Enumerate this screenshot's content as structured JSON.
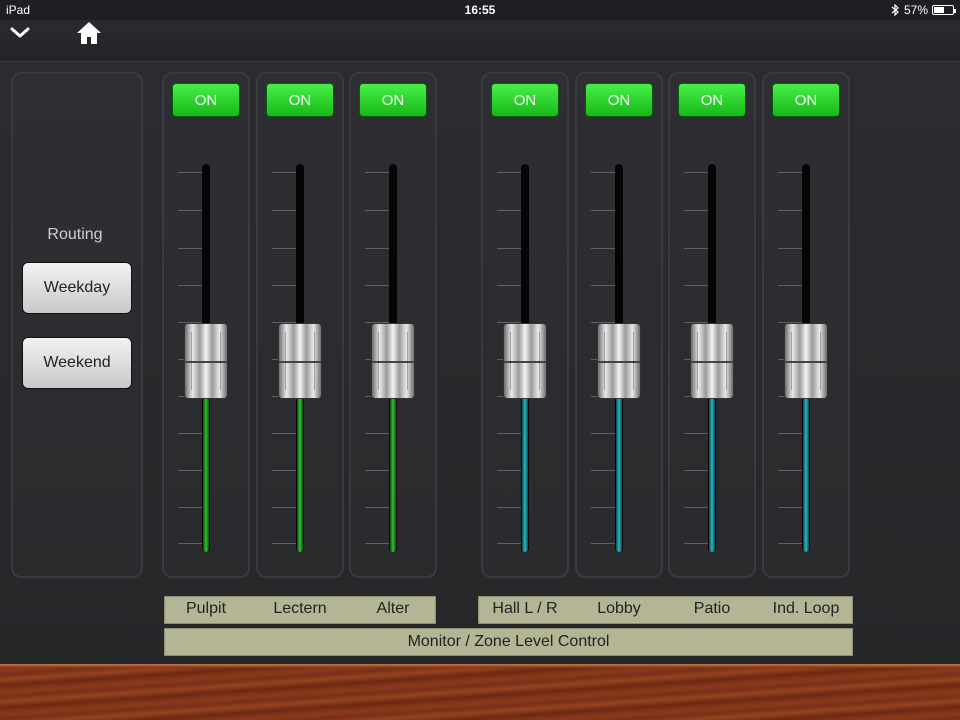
{
  "status_bar": {
    "device": "iPad",
    "time": "16:55",
    "battery": "57%",
    "battery_level": 0.57
  },
  "toolbar": {
    "left_icon": "chevron-down-icon",
    "home_icon": "home-icon"
  },
  "routing": {
    "label": "Routing",
    "buttons": [
      "Weekday",
      "Weekend"
    ]
  },
  "channels": [
    {
      "name": "Pulpit",
      "on_label": "ON",
      "level": 0.5,
      "color": "#2ec12e"
    },
    {
      "name": "Lectern",
      "on_label": "ON",
      "level": 0.5,
      "color": "#2ec12e"
    },
    {
      "name": "Alter",
      "on_label": "ON",
      "level": 0.5,
      "color": "#2ec12e"
    },
    {
      "name": "Hall L / R",
      "on_label": "ON",
      "level": 0.5,
      "color": "#27b6c1"
    },
    {
      "name": "Lobby",
      "on_label": "ON",
      "level": 0.5,
      "color": "#27b6c1"
    },
    {
      "name": "Patio",
      "on_label": "ON",
      "level": 0.5,
      "color": "#27b6c1"
    },
    {
      "name": "Ind. Loop",
      "on_label": "ON",
      "level": 0.5,
      "color": "#27b6c1"
    }
  ],
  "footer": {
    "title": "Monitor / Zone Level Control"
  },
  "colors": {
    "on_button": "#2fd82f",
    "label_bar": "#b4b595",
    "background": "#26272a"
  }
}
